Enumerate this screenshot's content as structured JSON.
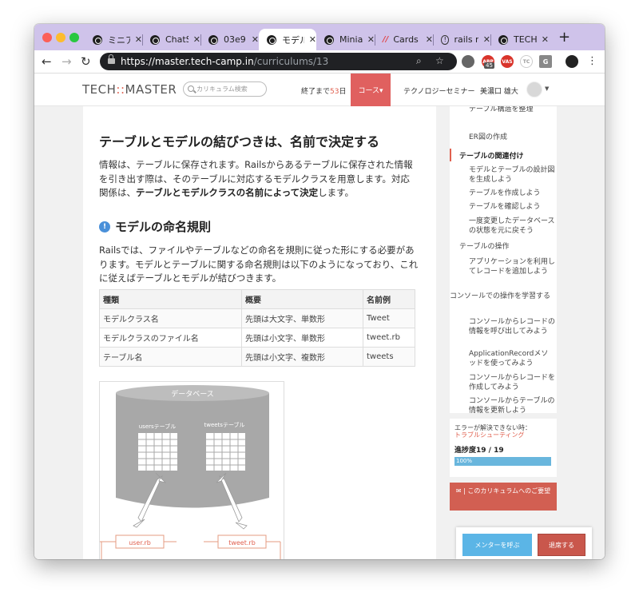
{
  "browser": {
    "tabs": [
      {
        "label": "ミニア"
      },
      {
        "label": "ChatS"
      },
      {
        "label": "03e9"
      },
      {
        "label": "モデル"
      },
      {
        "label": "Miniap"
      },
      {
        "label": "Cards"
      },
      {
        "label": "rails r"
      },
      {
        "label": "TECH"
      }
    ],
    "url_host": "https://master.tech-camp.in",
    "url_path": "/curriculums/13",
    "ext_badge": "45"
  },
  "site": {
    "logo_main": "TECH",
    "logo_sep": "::",
    "logo_tail": "MASTER",
    "search_placeholder": "カリキュラム検索",
    "days_prefix": "終了まで",
    "days_value": "53",
    "days_suffix": "日",
    "course_label": "コース▾",
    "seminar": "テクノロジーセミナー",
    "user_name": "美濃口 雄大"
  },
  "main": {
    "heading": "テーブルとモデルの結びつきは、名前で決定する",
    "para1": "情報は、テーブルに保存されます。Railsからあるテーブルに保存された情報を引き出す際は、そのテーブルに対応するモデルクラスを用意します。対応関係は、",
    "para1_bold": "テーブルとモデルクラスの名前によって決定",
    "para1_end": "します。",
    "section_title": "モデルの命名規則",
    "para2": "Railsでは、ファイルやテーブルなどの命名を規則に従った形にする必要があります。モデルとテーブルに関する命名規則は以下のようになっており、これに従えばテーブルとモデルが結びつきます。",
    "table": {
      "headers": [
        "種類",
        "概要",
        "名前例"
      ],
      "rows": [
        [
          "モデルクラス名",
          "先頭は大文字、単数形",
          "Tweet"
        ],
        [
          "モデルクラスのファイル名",
          "先頭は小文字、単数形",
          "tweet.rb"
        ],
        [
          "テーブル名",
          "先頭は小文字、複数形",
          "tweets"
        ]
      ]
    },
    "diagram": {
      "db_label": "データベース",
      "users_table": "usersテーブル",
      "tweets_table": "tweetsテーブル",
      "user_file": "user.rb",
      "tweet_file": "tweet.rb"
    }
  },
  "sidebar": {
    "items": [
      "テーブル構造を整理",
      "ER図の作成",
      "テーブルの関連付け",
      "モデルとテーブルの設計図を生成しよう",
      "テーブルを作成しよう",
      "テーブルを確認しよう",
      "一度変更したデータベースの状態を元に戻そう",
      "テーブルの操作",
      "アプリケーションを利用してレコードを追加しよう",
      "コンソールでの操作を学習する",
      "コンソールからレコードの情報を呼び出してみよう",
      "ApplicationRecordメソッドを使ってみよう",
      "コンソールからレコードを作成してみよう",
      "コンソールからテーブルの情報を更新しよう"
    ],
    "error_prefix": "エラーが解決できない時：",
    "error_link": "トラブルシューティング",
    "progress_label": "進捗度19 / 19",
    "progress_text": "100%",
    "progress_value": 1.0,
    "request_button": "✉ | このカリキュラムへのご要望",
    "call_mentor": "メンターを呼ぶ",
    "leave": "退席する"
  },
  "colors": {
    "accent": "#e0604f",
    "tabbar": "#cfc3ea",
    "progress": "#69b6dd",
    "call": "#5bb5e6"
  }
}
